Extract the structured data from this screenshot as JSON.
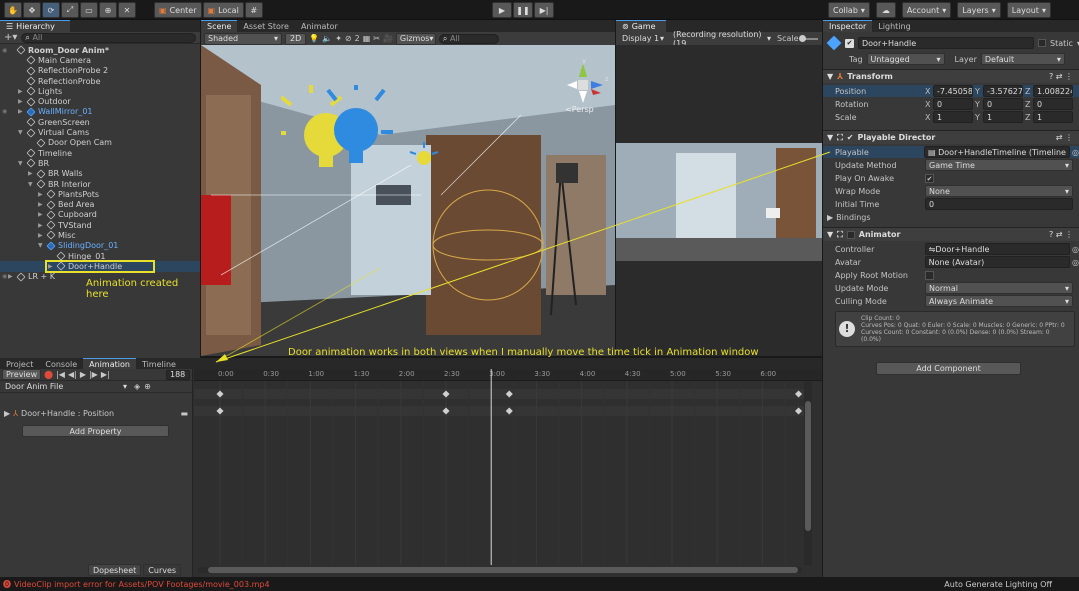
{
  "toolbar": {
    "center_label": "Center",
    "local_label": "Local",
    "collab_label": "Collab",
    "account_label": "Account",
    "layers_label": "Layers",
    "layout_label": "Layout"
  },
  "hierarchy": {
    "tab_label": "Hierarchy",
    "search_placeholder": "All",
    "items": [
      {
        "label": "Room_Door Anim*",
        "indent": 0,
        "icon": "scene",
        "bold": true
      },
      {
        "label": "Main Camera",
        "indent": 1,
        "icon": "cube"
      },
      {
        "label": "ReflectionProbe 2",
        "indent": 1,
        "icon": "cube"
      },
      {
        "label": "ReflectionProbe",
        "indent": 1,
        "icon": "cube"
      },
      {
        "label": "Lights",
        "indent": 1,
        "icon": "cube",
        "arrow": "▶"
      },
      {
        "label": "Outdoor",
        "indent": 1,
        "icon": "cube",
        "arrow": "▶"
      },
      {
        "label": "WallMirror_01",
        "indent": 1,
        "icon": "cube-blue",
        "arrow": "▶",
        "blue": true
      },
      {
        "label": "GreenScreen",
        "indent": 1,
        "icon": "cube"
      },
      {
        "label": "Virtual Cams",
        "indent": 1,
        "icon": "cube",
        "arrow": "▼"
      },
      {
        "label": "Door Open Cam",
        "indent": 2,
        "icon": "cube"
      },
      {
        "label": "Timeline",
        "indent": 1,
        "icon": "cube"
      },
      {
        "label": "BR",
        "indent": 1,
        "icon": "cube",
        "arrow": "▼"
      },
      {
        "label": "BR Walls",
        "indent": 2,
        "icon": "cube",
        "arrow": "▶"
      },
      {
        "label": "BR Interior",
        "indent": 2,
        "icon": "cube",
        "arrow": "▼"
      },
      {
        "label": "PlantsPots",
        "indent": 3,
        "icon": "cube",
        "arrow": "▶"
      },
      {
        "label": "Bed Area",
        "indent": 3,
        "icon": "cube",
        "arrow": "▶"
      },
      {
        "label": "Cupboard",
        "indent": 3,
        "icon": "cube",
        "arrow": "▶"
      },
      {
        "label": "TVStand",
        "indent": 3,
        "icon": "cube",
        "arrow": "▶"
      },
      {
        "label": "Misc",
        "indent": 3,
        "icon": "cube",
        "arrow": "▶"
      },
      {
        "label": "SlidingDoor_01",
        "indent": 3,
        "icon": "cube-blue",
        "arrow": "▼",
        "blue": true
      },
      {
        "label": "Hinge_01",
        "indent": 4,
        "icon": "cube"
      },
      {
        "label": "Door+Handle",
        "indent": 4,
        "icon": "cube",
        "arrow": "▶"
      },
      {
        "label": "LR + K",
        "indent": 0,
        "icon": "cube",
        "arrow": "▶"
      }
    ]
  },
  "scene": {
    "tabs": [
      "Scene",
      "Asset Store",
      "Animator"
    ],
    "shading": "Shaded",
    "mode_2d": "2D",
    "gizmo_count": "2",
    "gizmos_label": "Gizmos",
    "search_placeholder": "All",
    "persp_label": "Persp",
    "axis_y": "y",
    "axis_z": "z"
  },
  "game": {
    "tab_label": "Game",
    "display": "Display 1",
    "resolution": "(Recording resolution) (19",
    "scale_label": "Scale"
  },
  "inspector": {
    "tabs": [
      "Inspector",
      "Lighting"
    ],
    "object_name": "Door+Handle",
    "static_label": "Static",
    "tag_label": "Tag",
    "tag_value": "Untagged",
    "layer_label": "Layer",
    "layer_value": "Default",
    "transform": {
      "title": "Transform",
      "position_label": "Position",
      "rotation_label": "Rotation",
      "scale_label": "Scale",
      "position": [
        "-7.450581",
        "-3.576279",
        "1.008224"
      ],
      "rotation": [
        "0",
        "0",
        "0"
      ],
      "scale": [
        "1",
        "1",
        "1"
      ]
    },
    "director": {
      "title": "Playable Director",
      "playable_label": "Playable",
      "playable_value": "Door+HandleTimeline (TimelineAss",
      "update_method_label": "Update Method",
      "update_method_value": "Game Time",
      "play_on_awake_label": "Play On Awake",
      "wrap_mode_label": "Wrap Mode",
      "wrap_mode_value": "None",
      "initial_time_label": "Initial Time",
      "initial_time_value": "0",
      "bindings_label": "Bindings"
    },
    "animator": {
      "title": "Animator",
      "controller_label": "Controller",
      "controller_value": "Door+Handle",
      "avatar_label": "Avatar",
      "avatar_value": "None (Avatar)",
      "apply_root_label": "Apply Root Motion",
      "update_mode_label": "Update Mode",
      "update_mode_value": "Normal",
      "culling_label": "Culling Mode",
      "culling_value": "Always Animate",
      "info_lines": [
        "Clip Count: 0",
        "Curves Pos: 0 Quat: 0 Euler: 0 Scale: 0 Muscles: 0 Generic: 0 PPtr: 0",
        "Curves Count: 0 Constant: 0 (0.0%) Dense: 0 (0.0%) Stream: 0",
        "(0.0%)"
      ]
    },
    "add_component": "Add Component"
  },
  "animation": {
    "tabs": [
      "Project",
      "Console",
      "Animation",
      "Timeline"
    ],
    "preview_label": "Preview",
    "frame_value": "188",
    "clip_name": "Door Anim File",
    "property_label": "Door+Handle : Position",
    "add_property": "Add Property",
    "dopesheet_label": "Dopesheet",
    "curves_label": "Curves",
    "time_ticks": [
      "0:00",
      "0:30",
      "1:00",
      "1:30",
      "2:00",
      "2:30",
      "3:00",
      "3:30",
      "4:00",
      "4:30",
      "5:00",
      "5:30",
      "6:00"
    ],
    "keyframe_times": [
      0,
      2.5,
      3.2,
      6.4
    ]
  },
  "annotations": {
    "animation_created": "Animation created here",
    "door_note": "Door animation works in both views when I manually move the time tick in Animation window"
  },
  "status": {
    "error_text": "VideoClip import error for Assets/POV Footages/movie_003.mp4",
    "lighting_text": "Auto Generate Lighting Off"
  },
  "colors": {
    "accent_blue": "#4a9be8",
    "annotation_yellow": "#e8e02a",
    "error_red": "#e04a3a"
  }
}
